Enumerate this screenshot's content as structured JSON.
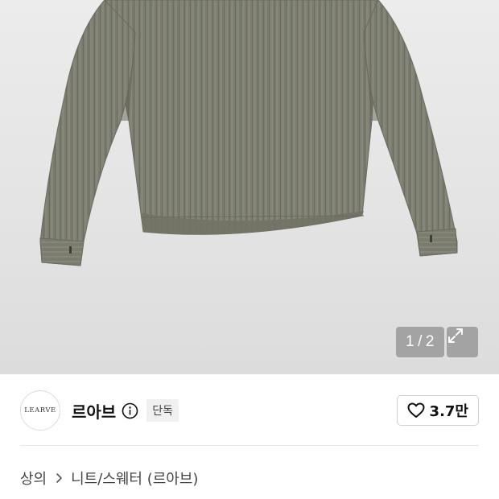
{
  "gallery": {
    "current_page": "1",
    "separator": "/",
    "total_pages": "2"
  },
  "brand": {
    "logo_text": "LEARVE",
    "name": "르아브",
    "badge": "단독"
  },
  "like": {
    "count": "3.7만"
  },
  "breadcrumb": {
    "category": "상의",
    "subcategory": "니트/스웨터 (르아브)"
  },
  "colors": {
    "sweater": "#7a7b6c",
    "image_background": "#e6e6e6",
    "overlay": "#8c8c8c"
  }
}
